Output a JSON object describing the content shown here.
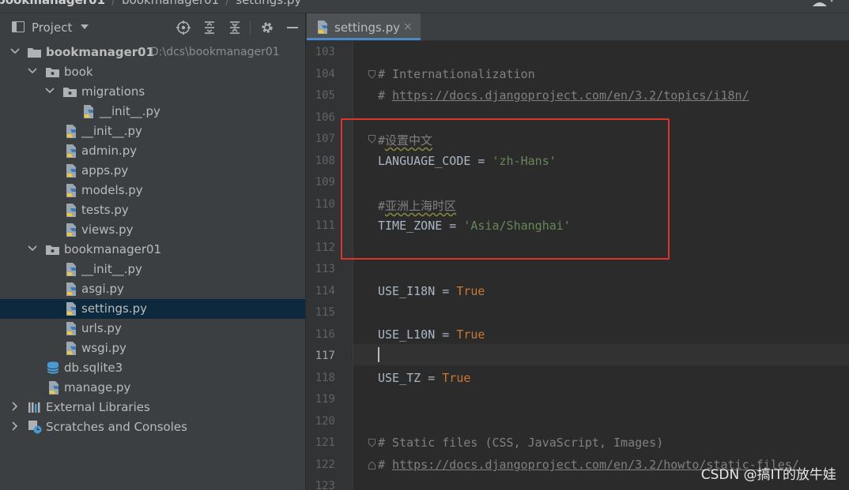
{
  "breadcrumb": {
    "items": [
      "bookmanager01",
      "bookmanager01",
      "settings.py"
    ]
  },
  "project_panel": {
    "title": "Project",
    "header_icons": [
      "locate-icon",
      "expand-all-icon",
      "collapse-all-icon",
      "gear-icon",
      "hide-icon"
    ],
    "tree": [
      {
        "label": "bookmanager01",
        "path": "D:\\dcs\\bookmanager01",
        "type": "root-folder",
        "expanded": true
      },
      {
        "label": "book",
        "type": "package",
        "expanded": true
      },
      {
        "label": "migrations",
        "type": "package",
        "expanded": true
      },
      {
        "label": "__init__.py",
        "type": "python-file"
      },
      {
        "label": "__init__.py",
        "type": "python-file"
      },
      {
        "label": "admin.py",
        "type": "python-file"
      },
      {
        "label": "apps.py",
        "type": "python-file"
      },
      {
        "label": "models.py",
        "type": "python-file"
      },
      {
        "label": "tests.py",
        "type": "python-file"
      },
      {
        "label": "views.py",
        "type": "python-file"
      },
      {
        "label": "bookmanager01",
        "type": "package",
        "expanded": true
      },
      {
        "label": "__init__.py",
        "type": "python-file"
      },
      {
        "label": "asgi.py",
        "type": "python-file"
      },
      {
        "label": "settings.py",
        "type": "python-file",
        "selected": true
      },
      {
        "label": "urls.py",
        "type": "python-file"
      },
      {
        "label": "wsgi.py",
        "type": "python-file"
      },
      {
        "label": "db.sqlite3",
        "type": "database-file"
      },
      {
        "label": "manage.py",
        "type": "python-file"
      },
      {
        "label": "External Libraries",
        "type": "libraries",
        "expanded": false
      },
      {
        "label": "Scratches and Consoles",
        "type": "scratches",
        "expanded": false
      }
    ]
  },
  "editor": {
    "tab": {
      "label": "settings.py",
      "close": "×"
    },
    "current_line": 117,
    "lines": [
      {
        "n": "103",
        "text": ""
      },
      {
        "n": "104",
        "text": "# Internationalization"
      },
      {
        "n": "105",
        "prefix": "# ",
        "link": "https://docs.djangoproject.com/en/3.2/topics/i18n/"
      },
      {
        "n": "106",
        "text": ""
      },
      {
        "n": "107",
        "prefix": "#",
        "cjk": "设置中文"
      },
      {
        "n": "108",
        "name": "LANGUAGE_CODE",
        "op": " = ",
        "str": "'zh-Hans'"
      },
      {
        "n": "109",
        "text": ""
      },
      {
        "n": "110",
        "prefix": "#",
        "cjk": "亚洲上海时区"
      },
      {
        "n": "111",
        "name": "TIME_ZONE",
        "op": " = ",
        "str": "'Asia/Shanghai'"
      },
      {
        "n": "112",
        "text": ""
      },
      {
        "n": "113",
        "text": ""
      },
      {
        "n": "114",
        "name": "USE_I18N",
        "op": " = ",
        "kw": "True"
      },
      {
        "n": "115",
        "text": ""
      },
      {
        "n": "116",
        "name": "USE_L10N",
        "op": " = ",
        "kw": "True"
      },
      {
        "n": "117",
        "text": ""
      },
      {
        "n": "118",
        "name": "USE_TZ",
        "op": " = ",
        "kw": "True"
      },
      {
        "n": "119",
        "text": ""
      },
      {
        "n": "120",
        "text": ""
      },
      {
        "n": "121",
        "text": "# Static files (CSS, JavaScript, Images)"
      },
      {
        "n": "122",
        "prefix": "# ",
        "link": "https://docs.djangoproject.com/en/3.2/howto/static-files/"
      },
      {
        "n": "123",
        "text": ""
      }
    ]
  },
  "watermark": "CSDN @搞IT的放牛娃"
}
